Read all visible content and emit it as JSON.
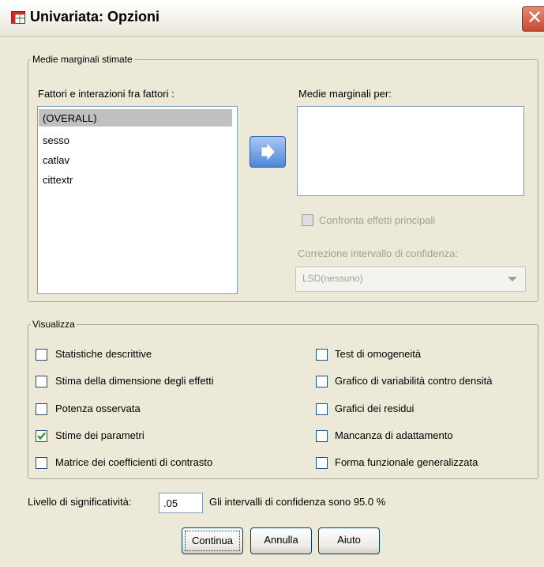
{
  "window": {
    "title": "Univariata: Opzioni",
    "close_glyph": "✕"
  },
  "emm": {
    "group_label": "Medie marginali stimate",
    "factors_label": "Fattori e interazioni fra fattori :",
    "factors": [
      "(OVERALL)",
      "sesso",
      "catlav",
      "cittextr"
    ],
    "means_for_label": "Medie marginali per:",
    "compare_label": "Confronta effetti principali",
    "ci_adjust_label": "Correzione intervallo di confidenza:",
    "ci_adjust_value": "LSD(nessuno)"
  },
  "display": {
    "group_label": "Visualizza",
    "left": [
      {
        "label": "Statistiche descrittive",
        "checked": false
      },
      {
        "label": "Stima della dimensione degli effetti",
        "checked": false
      },
      {
        "label": "Potenza osservata",
        "checked": false
      },
      {
        "label": "Stime dei parametri",
        "checked": true
      },
      {
        "label": "Matrice dei coefficienti di contrasto",
        "checked": false
      }
    ],
    "right": [
      {
        "label": "Test di omogeneità",
        "checked": false
      },
      {
        "label": "Grafico di variabilità contro densità",
        "checked": false
      },
      {
        "label": "Grafici dei residui",
        "checked": false
      },
      {
        "label": "Mancanza di adattamento",
        "checked": false
      },
      {
        "label": "Forma funzionale generalizzata",
        "checked": false
      }
    ]
  },
  "significance": {
    "label": "Livello di significatività:",
    "value": ".05",
    "ci_text": "Gli intervalli di confidenza sono 95.0 %"
  },
  "buttons": {
    "continue": "Continua",
    "cancel": "Annulla",
    "help": "Aiuto"
  },
  "icons": {
    "app": "spss-table-icon",
    "arrow": "move-right-arrow-icon",
    "check": "checkmark-icon"
  }
}
